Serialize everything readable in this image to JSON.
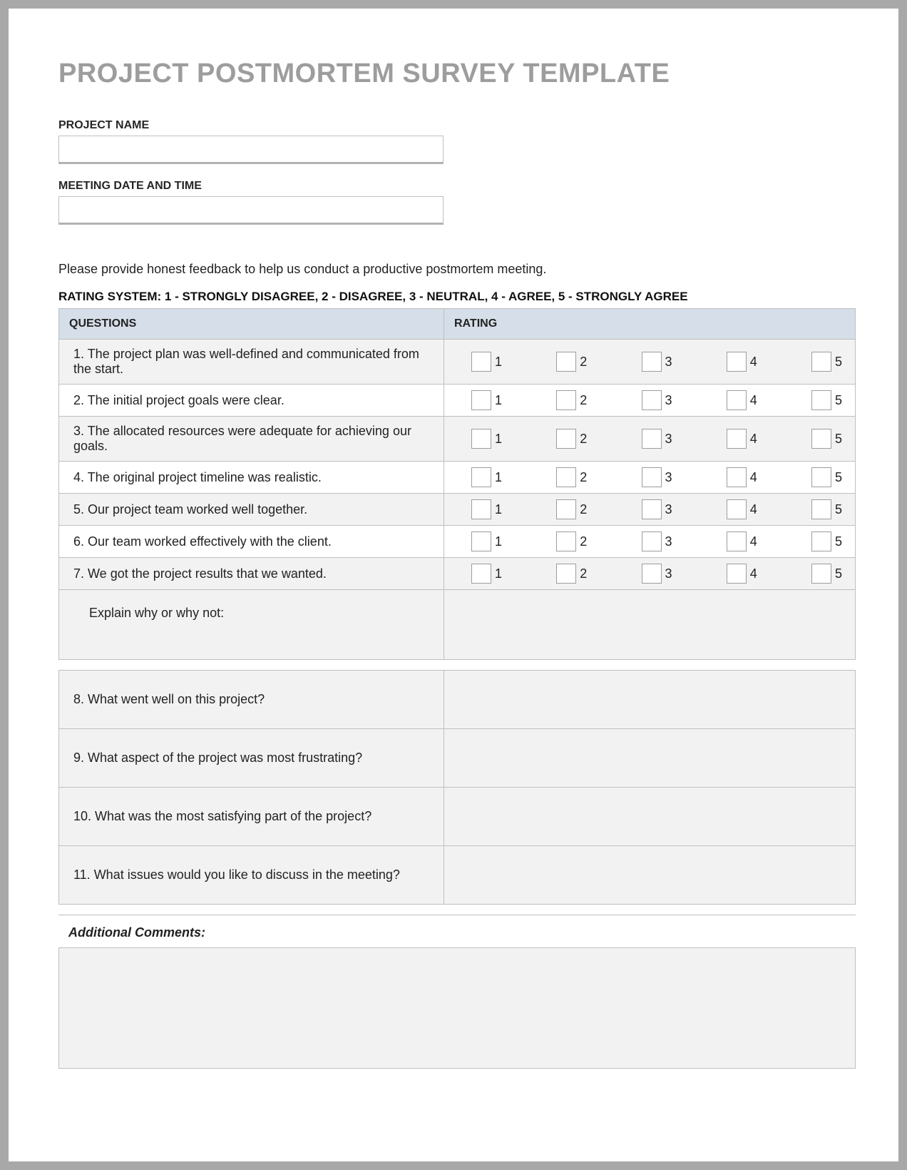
{
  "title": "PROJECT POSTMORTEM SURVEY TEMPLATE",
  "fields": {
    "project_name_label": "PROJECT NAME",
    "meeting_label": "MEETING DATE AND TIME"
  },
  "intro": "Please provide honest feedback to help us conduct a productive postmortem meeting.",
  "rating_legend": "RATING SYSTEM: 1 - STRONGLY DISAGREE, 2 - DISAGREE, 3 - NEUTRAL, 4 - AGREE, 5 - STRONGLY AGREE",
  "headers": {
    "questions": "QUESTIONS",
    "rating": "RATING"
  },
  "rating_labels": [
    "1",
    "2",
    "3",
    "4",
    "5"
  ],
  "questions": [
    "1. The project plan was well-defined and communicated from the start.",
    "2. The initial project goals were clear.",
    "3. The allocated resources were adequate for achieving our goals.",
    "4. The original project timeline was realistic.",
    "5. Our project team worked well together.",
    "6. Our team worked effectively with the client.",
    "7. We got the project results that we wanted."
  ],
  "explain_label": "Explain why or why not:",
  "open_questions": [
    "8. What went well on this project?",
    "9. What aspect of the project was most frustrating?",
    "10. What was the most satisfying part of the project?",
    "11. What issues would you like to discuss in the meeting?"
  ],
  "additional_label": "Additional Comments:"
}
